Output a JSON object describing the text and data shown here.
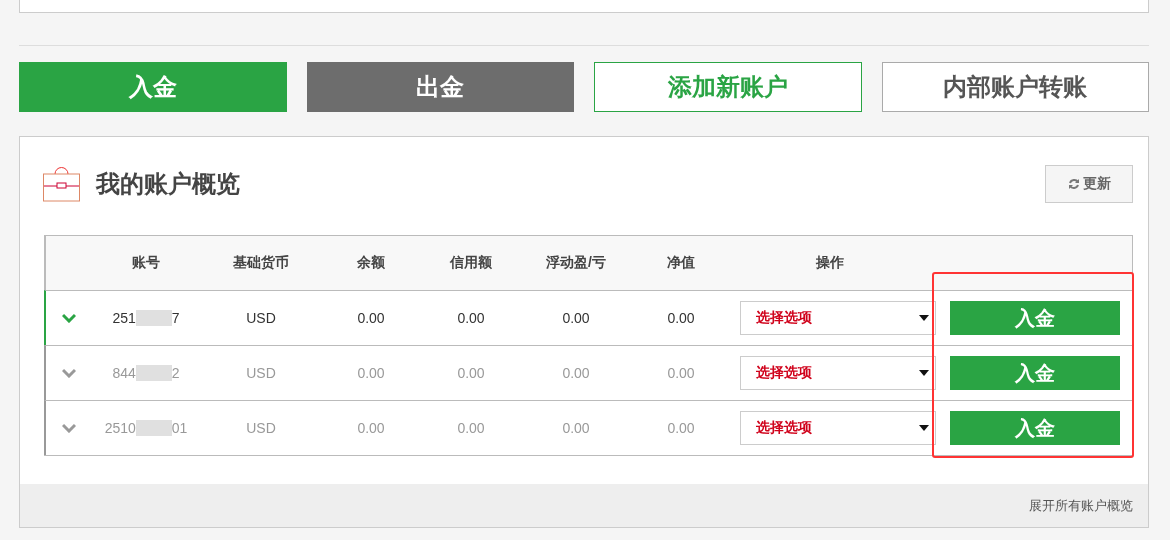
{
  "actions": [
    {
      "label": "入金",
      "kind": "primary"
    },
    {
      "label": "出金",
      "kind": "dark"
    },
    {
      "label": "添加新账户",
      "kind": "outline"
    },
    {
      "label": "内部账户转账",
      "kind": "plain"
    }
  ],
  "overview": {
    "title": "我的账户概览",
    "refresh_button": "更新",
    "columns": [
      "账号",
      "基础货币",
      "余额",
      "信用额",
      "浮动盈/亏",
      "净值",
      "操作"
    ],
    "rows": [
      {
        "selected": true,
        "account_start": "251",
        "account_end": "7",
        "currency": "USD",
        "balance": "0.00",
        "credit": "0.00",
        "pnl": "0.00",
        "equity": "0.00",
        "select_placeholder": "选择选项",
        "button": "入金"
      },
      {
        "selected": false,
        "account_start": "844",
        "account_end": "2",
        "currency": "USD",
        "balance": "0.00",
        "credit": "0.00",
        "pnl": "0.00",
        "equity": "0.00",
        "select_placeholder": "选择选项",
        "button": "入金"
      },
      {
        "selected": false,
        "account_start": "2510",
        "account_end": "01",
        "currency": "USD",
        "balance": "0.00",
        "credit": "0.00",
        "pnl": "0.00",
        "equity": "0.00",
        "select_placeholder": "选择选项",
        "button": "入金"
      }
    ],
    "footer_link": "展开所有账户概览"
  }
}
